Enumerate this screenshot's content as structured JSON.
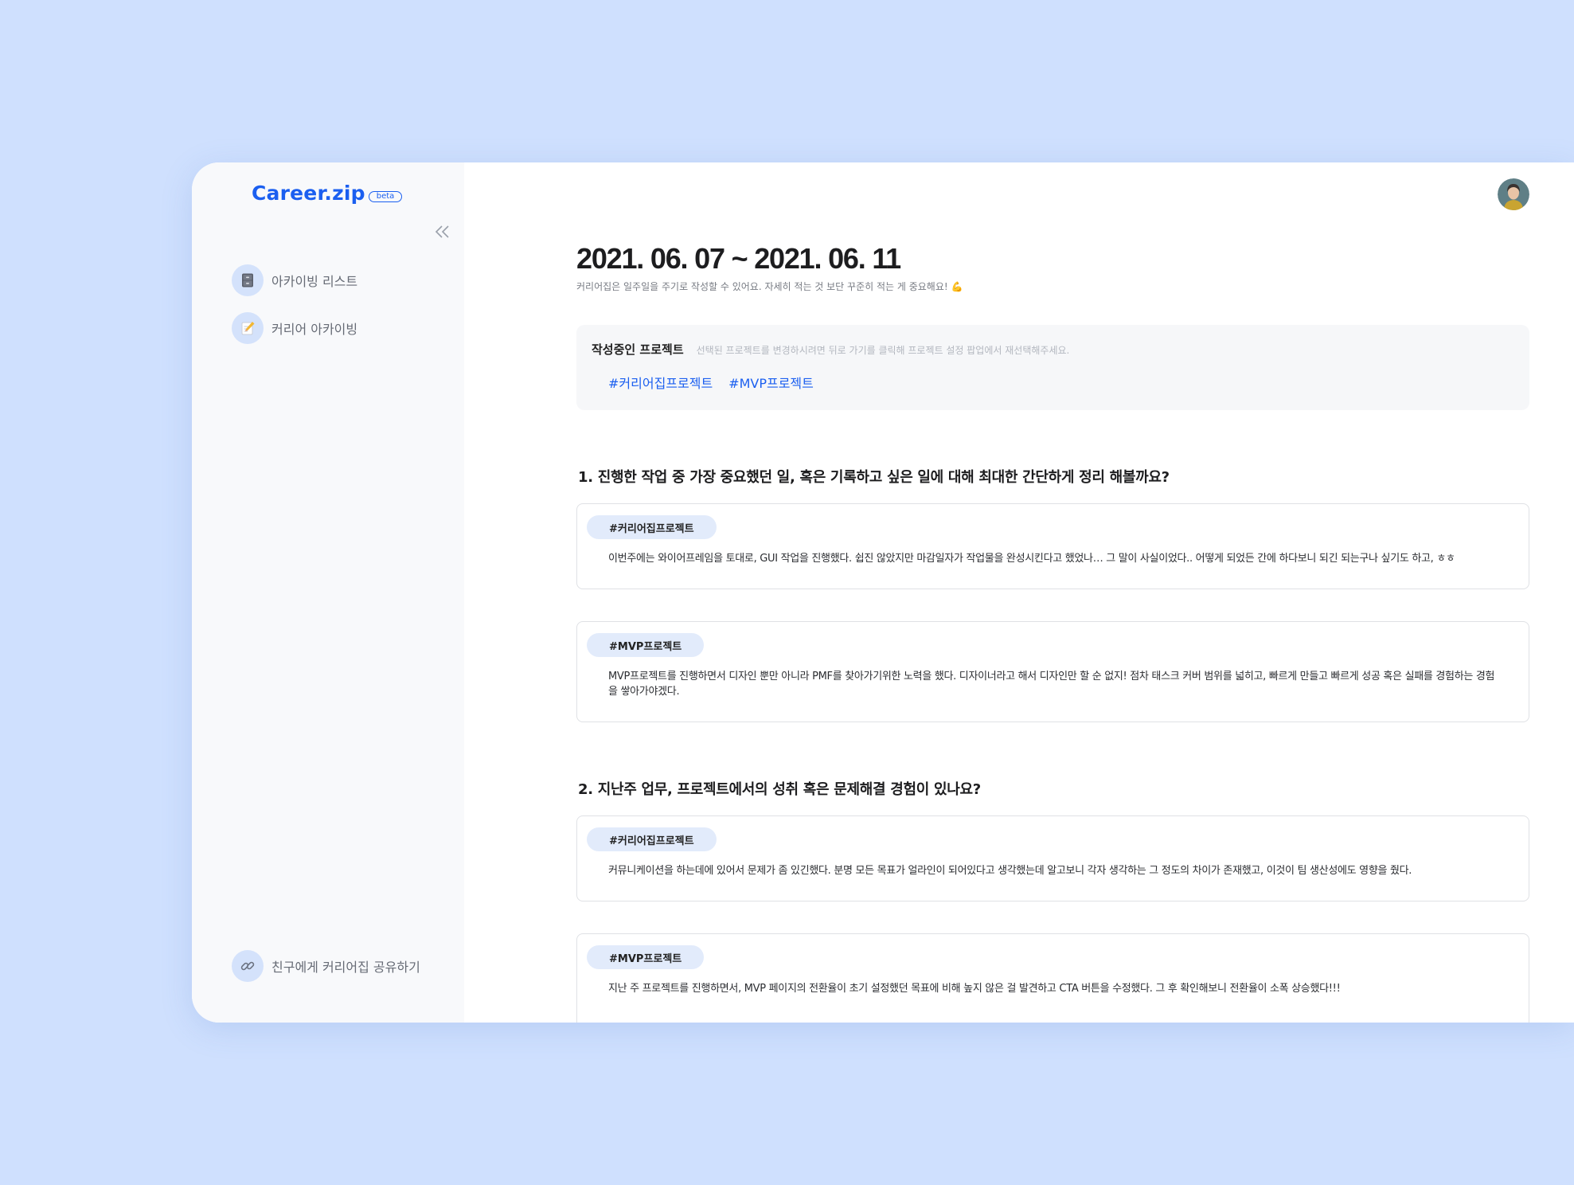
{
  "app": {
    "name": "Career.zip",
    "badge": "beta"
  },
  "sidebar": {
    "items": [
      {
        "label": "아카이빙 리스트",
        "icon": "file-cabinet-icon"
      },
      {
        "label": "커리어 아카이빙",
        "icon": "memo-icon"
      }
    ],
    "share": {
      "label": "친구에게 커리어집 공유하기",
      "icon": "link-icon"
    }
  },
  "main": {
    "date_range": "2021. 06. 07 ~ 2021. 06. 11",
    "subtitle": "커리어집은 일주일을 주기로 작성할 수 있어요. 자세히 적는 것 보단 꾸준히 적는 게 중요해요! 💪",
    "project_box": {
      "title": "작성중인 프로젝트",
      "hint": "선택된 프로젝트를 변경하시려면 뒤로 가기를 클릭해 프로젝트 설정 팝업에서 재선택해주세요.",
      "tags": [
        "#커리어집프로젝트",
        "#MVP프로젝트"
      ]
    },
    "questions": [
      {
        "title": "1. 진행한 작업 중 가장 중요했던 일, 혹은 기록하고 싶은 일에 대해 최대한 간단하게 정리 해볼까요?",
        "answers": [
          {
            "tag": "#커리어집프로젝트",
            "text": "이번주에는 와이어프레임을 토대로, GUI 작업을 진행했다. 쉽진 않았지만 마감일자가 작업물을 완성시킨다고 했었나… 그 말이 사실이었다.. 어떻게 되었든 간에 하다보니 되긴 되는구나 싶기도 하고, ㅎㅎ"
          },
          {
            "tag": "#MVP프로젝트",
            "text": "MVP프로젝트를 진행하면서 디자인 뿐만 아니라 PMF를 찾아가기위한 노력을 했다. 디자이너라고 해서 디자인만 할 순 없지! 점차 태스크 커버 범위를 넓히고, 빠르게 만들고 빠르게 성공 혹은 실패를 경험하는 경험을 쌓아가야겠다."
          }
        ]
      },
      {
        "title": "2. 지난주 업무, 프로젝트에서의 성취 혹은 문제해결 경험이 있나요?",
        "answers": [
          {
            "tag": "#커리어집프로젝트",
            "text": "커뮤니케이션을 하는데에 있어서 문제가 좀 있긴했다. 분명 모든 목표가 얼라인이 되어있다고 생각했는데 알고보니 각자 생각하는 그 정도의 차이가 존재했고, 이것이 팀 생산성에도 영향을 줬다."
          },
          {
            "tag": "#MVP프로젝트",
            "text": "지난 주 프로젝트를 진행하면서, MVP 페이지의 전환율이 초기 설정했던 목표에 비해 높지 않은 걸 발견하고 CTA 버튼을 수정했다. 그 후 확인해보니 전환율이 소폭 상승했다!!!"
          }
        ]
      }
    ]
  },
  "colors": {
    "background": "#cfe0fe",
    "accent": "#1b5ff0",
    "tag_bg": "#e2ebfb",
    "sidebar_bg": "#f8f9fb"
  }
}
